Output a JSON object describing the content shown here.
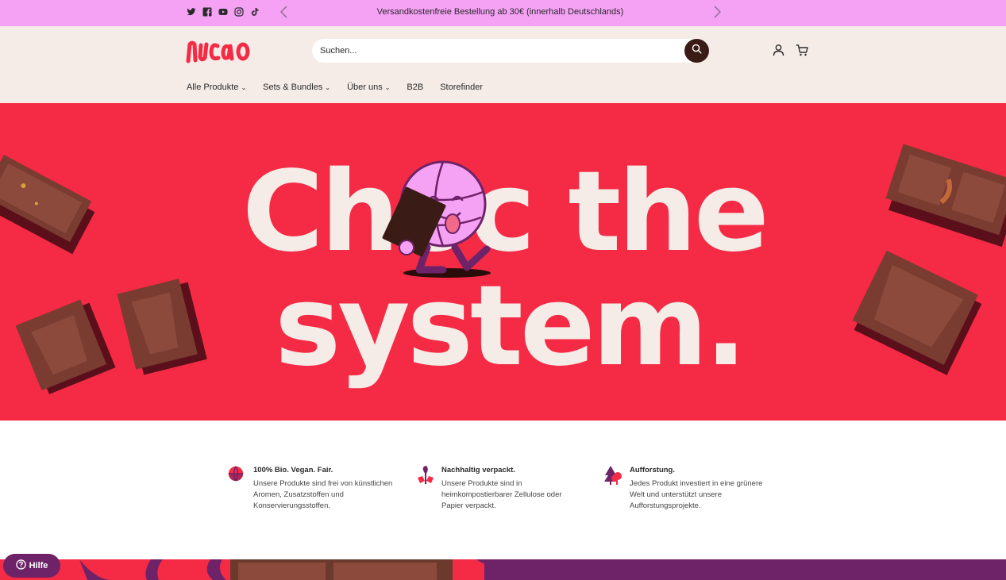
{
  "announcement": {
    "text": "Versandkostenfreie Bestellung ab 30€ (innerhalb Deutschlands)",
    "background": "#f5a2f5",
    "social_icons": [
      "twitter-icon",
      "facebook-icon",
      "youtube-icon",
      "instagram-icon",
      "tiktok-icon"
    ]
  },
  "header": {
    "logo_text": "nucao",
    "search": {
      "placeholder": "Suchen..."
    },
    "nav": [
      {
        "label": "Alle Produkte",
        "has_dropdown": true
      },
      {
        "label": "Sets & Bundles",
        "has_dropdown": true
      },
      {
        "label": "Über uns",
        "has_dropdown": true
      },
      {
        "label": "B2B",
        "has_dropdown": false
      },
      {
        "label": "Storefinder",
        "has_dropdown": false
      }
    ],
    "background": "#f5ece8"
  },
  "hero": {
    "line1": "Choc the",
    "line2": "system.",
    "background": "#f52b45",
    "text_color": "#f5ece8"
  },
  "features": [
    {
      "icon": "globe-icon",
      "title": "100% Bio. Vegan. Fair.",
      "description": "Unsere Produkte sind frei von künstlichen Aromen, Zusatzstoffen und Konservierungsstoffen."
    },
    {
      "icon": "plant-icon",
      "title": "Nachhaltig verpackt.",
      "description": "Unsere Produkte sind in heimkompostierbarer Zellulose oder Papier verpackt."
    },
    {
      "icon": "tree-icon",
      "title": "Aufforstung.",
      "description": "Jedes Produkt investiert in eine grünere Welt und unterstützt unsere Aufforstungsprojekte."
    }
  ],
  "help": {
    "label": "Hilfe"
  },
  "colors": {
    "brand_red": "#f52b45",
    "brand_pink": "#f5a2f5",
    "dark_brown": "#3b1b15",
    "purple": "#6e2268"
  }
}
